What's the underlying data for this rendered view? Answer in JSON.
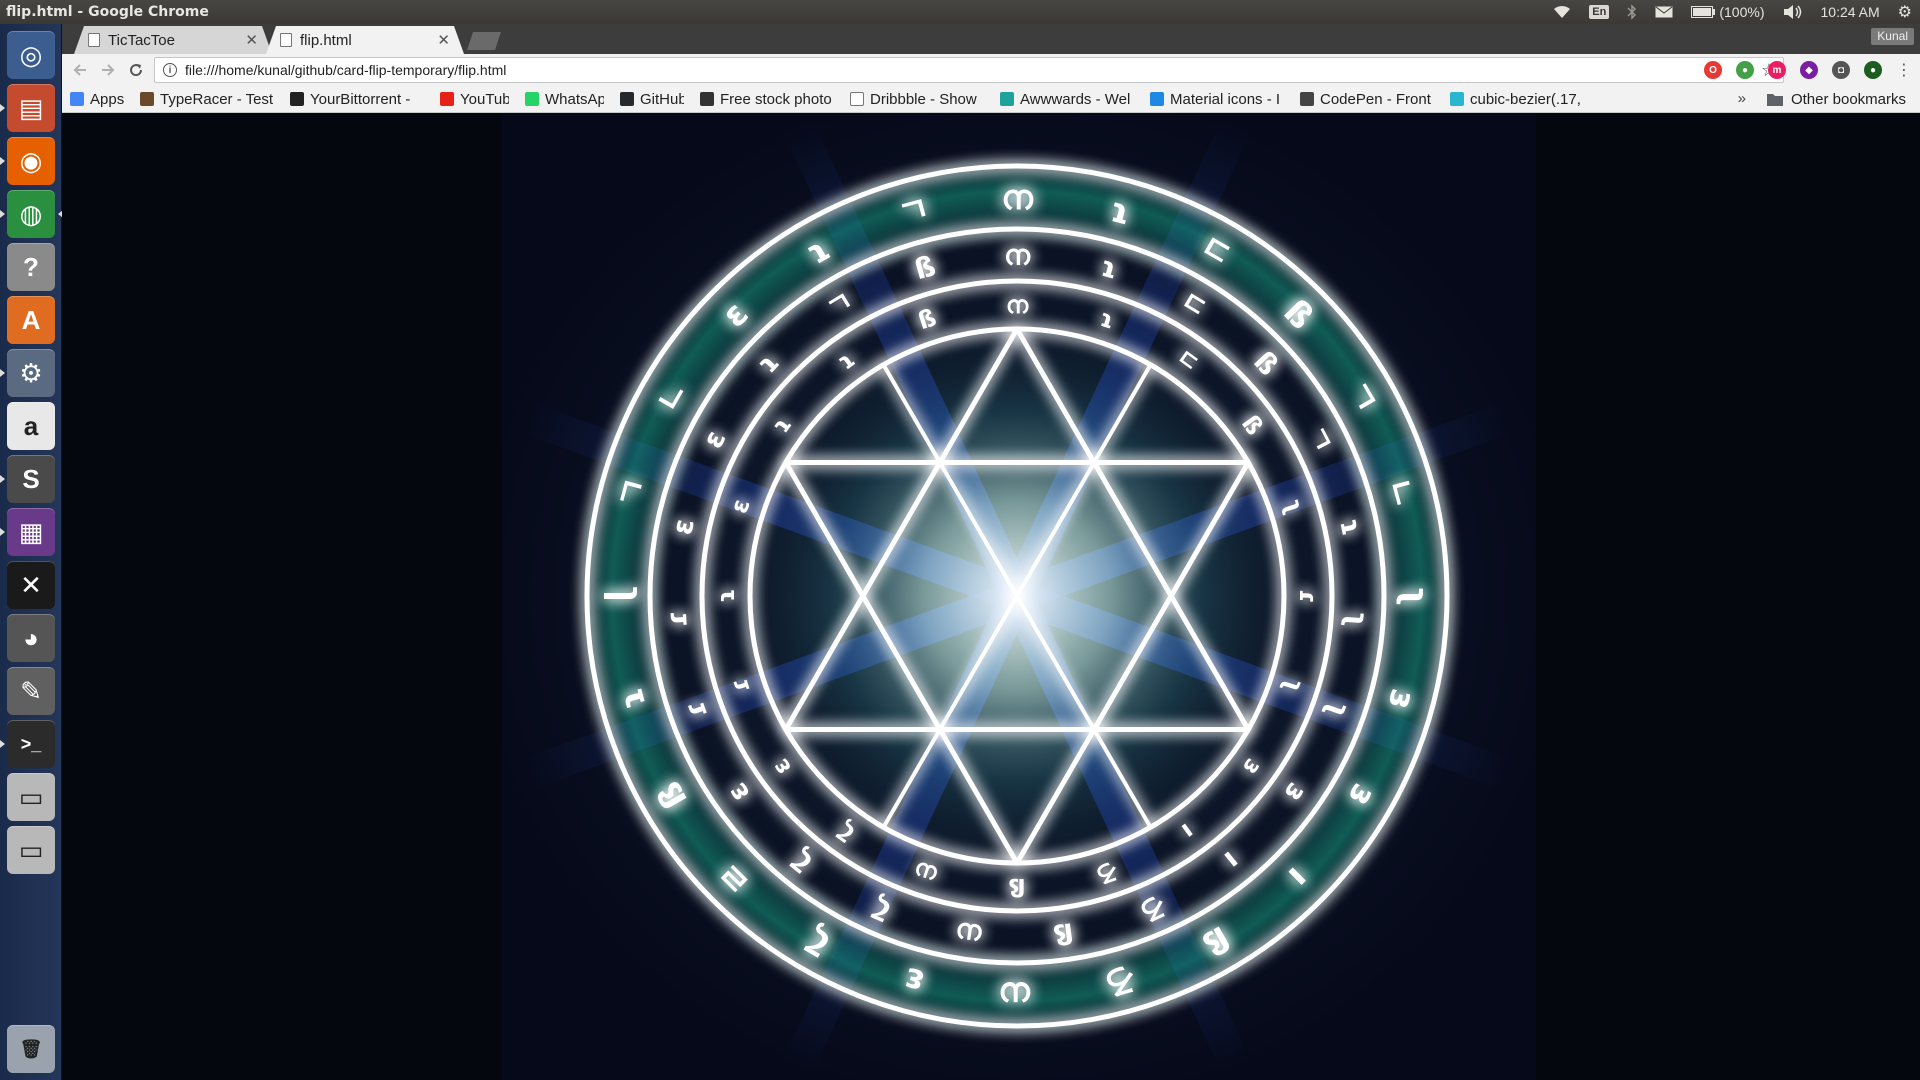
{
  "window": {
    "title": "flip.html - Google Chrome"
  },
  "panel": {
    "language": "En",
    "battery": "(100%)",
    "time": "10:24 AM"
  },
  "launcher": {
    "items": [
      {
        "name": "ubuntu-dash-icon",
        "color": "#3c5d8f",
        "glyph": "◎"
      },
      {
        "name": "files-icon",
        "color": "#c44b2e",
        "glyph": "▤"
      },
      {
        "name": "firefox-icon",
        "color": "#e66000",
        "glyph": "◉"
      },
      {
        "name": "chrome-icon",
        "color": "#2a8f3f",
        "glyph": "◍"
      },
      {
        "name": "help-icon",
        "color": "#8a8a8a",
        "glyph": "?"
      },
      {
        "name": "software-center-icon",
        "color": "#e06c21",
        "glyph": "A"
      },
      {
        "name": "system-settings-icon",
        "color": "#5a6a80",
        "glyph": "⚙"
      },
      {
        "name": "amazon-icon",
        "color": "#e8e8e8",
        "glyph": "a"
      },
      {
        "name": "sublime-text-icon",
        "color": "#4a4a4a",
        "glyph": "S"
      },
      {
        "name": "video-editor-icon",
        "color": "#6a3a8a",
        "glyph": "▦"
      },
      {
        "name": "xchat-icon",
        "color": "#1a1a1a",
        "glyph": "✕"
      },
      {
        "name": "webcam-icon",
        "color": "#555555",
        "glyph": "◕"
      },
      {
        "name": "gimp-icon",
        "color": "#606060",
        "glyph": "✎"
      },
      {
        "name": "terminal-icon",
        "color": "#2b2b2b",
        "glyph": ">_"
      },
      {
        "name": "drive-icon-1",
        "color": "#b8b8b8",
        "glyph": "▭"
      },
      {
        "name": "drive-icon-2",
        "color": "#b8b8b8",
        "glyph": "▭"
      },
      {
        "name": "trash-icon",
        "color": "#9aa3ad",
        "glyph": "🗑"
      }
    ]
  },
  "tabs": [
    {
      "label": "TicTacToe",
      "active": false
    },
    {
      "label": "flip.html",
      "active": true
    }
  ],
  "profile": "Kunal",
  "omnibox": {
    "url": "file:///home/kunal/github/card-flip-temporary/flip.html"
  },
  "bookmarks": [
    {
      "label": "Apps",
      "color": "#4285f4"
    },
    {
      "label": "TypeRacer - Test",
      "color": "#6b4a2a"
    },
    {
      "label": "YourBittorrent -",
      "color": "#222222"
    },
    {
      "label": "YouTube",
      "color": "#e62117"
    },
    {
      "label": "WhatsApp",
      "color": "#25d366"
    },
    {
      "label": "GitHub",
      "color": "#24292e"
    },
    {
      "label": "Free stock photo",
      "color": "#333333"
    },
    {
      "label": "Dribbble - Show",
      "color": "#ffffff"
    },
    {
      "label": "Awwwards - Wel",
      "color": "#1ba39c"
    },
    {
      "label": "Material icons - I",
      "color": "#1e88e5"
    },
    {
      "label": "CodePen - Front",
      "color": "#444444"
    },
    {
      "label": "cubic-bezier(.17,",
      "color": "#29b6d1"
    }
  ],
  "other_bookmarks": "Other bookmarks",
  "more_bookmarks": "»",
  "magic_circle": {
    "ring_color": "#ffffff",
    "glow_color": "#1de9b6",
    "outer_glyphs": [
      "ന",
      "ɿ",
      "ㄷ",
      "ß",
      "ㄱ",
      "ㄴ",
      "ʅ",
      "ɜ",
      "ɜ",
      "ı",
      "ß",
      "ろ",
      "ധ",
      "ɛ",
      "ζ",
      "ㄹ",
      "ß",
      "ɿ",
      "ɭ",
      "ㄱ",
      "ㄴ",
      "ɛ",
      "ɿ",
      "ㄱ"
    ],
    "middle_glyphs": [
      "ന",
      "ɿ",
      "ㄷ",
      "ß",
      "ㄱ",
      "ɿ",
      "ʅ",
      "ʅ",
      "ɜ",
      "ı",
      "ろ",
      "ß",
      "ധ",
      "ζ",
      "ζ",
      "ɛ",
      "ɾ",
      "ɾ",
      "ɛ",
      "ɛ",
      "ɿ",
      "ㄱ",
      "ß"
    ],
    "inner_glyphs": [
      "ന",
      "ɿ",
      "ㄷ",
      "ß",
      "ʅ",
      "ɾ",
      "ʅ",
      "ɜ",
      "ı",
      "ろ",
      "ß",
      "ധ",
      "ζ",
      "ɛ",
      "ɾ",
      "ɿ",
      "ɛ",
      "ɿ",
      "ɿ",
      "ß"
    ]
  }
}
